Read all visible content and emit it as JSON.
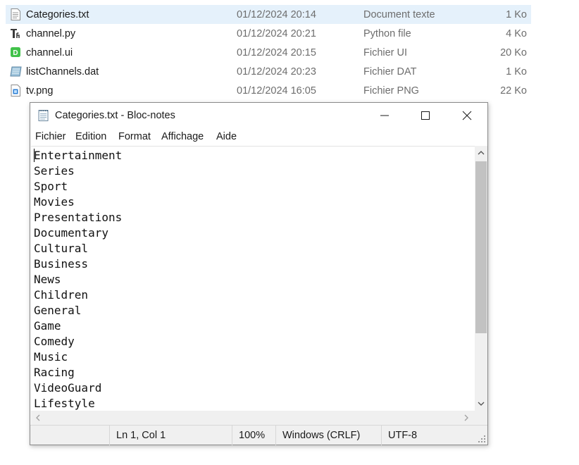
{
  "files": [
    {
      "name": "Categories.txt",
      "date": "01/12/2024 20:14",
      "type": "Document texte",
      "size": "1 Ko",
      "icon": "text-file-icon",
      "selected": true
    },
    {
      "name": "channel.py",
      "date": "01/12/2024 20:21",
      "type": "Python file",
      "size": "4 Ko",
      "icon": "python-file-icon",
      "selected": false
    },
    {
      "name": "channel.ui",
      "date": "01/12/2024 20:15",
      "type": "Fichier UI",
      "size": "20 Ko",
      "icon": "designer-file-icon",
      "selected": false
    },
    {
      "name": "listChannels.dat",
      "date": "01/12/2024 20:23",
      "type": "Fichier DAT",
      "size": "1 Ko",
      "icon": "dat-file-icon",
      "selected": false
    },
    {
      "name": "tv.png",
      "date": "01/12/2024 16:05",
      "type": "Fichier PNG",
      "size": "22 Ko",
      "icon": "image-file-icon",
      "selected": false
    }
  ],
  "notepad": {
    "title": "Categories.txt - Bloc-notes",
    "menu": [
      "Fichier",
      "Edition",
      "Format",
      "Affichage",
      "Aide"
    ],
    "lines": [
      "Entertainment",
      "Series",
      "Sport",
      "Movies",
      "Presentations",
      "Documentary",
      "Cultural",
      "Business",
      "News",
      "Children",
      "General",
      "Game",
      "Comedy",
      "Music",
      "Racing",
      "VideoGuard",
      "Lifestyle"
    ],
    "status": {
      "position": "Ln 1, Col 1",
      "zoom": "100%",
      "line_ending": "Windows (CRLF)",
      "encoding": "UTF-8"
    }
  },
  "colors": {
    "selection": "#e5f1fb",
    "window_chrome": "#f0f0f0",
    "scroll_thumb": "#c2c2c2"
  }
}
